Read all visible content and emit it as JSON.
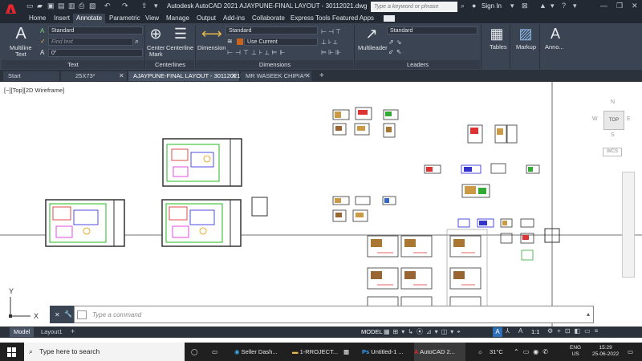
{
  "app": {
    "logo_letter": "A",
    "title": "Autodesk AutoCAD 2021    AJAYPUNE-FINAL LAYOUT - 30112021.dwg",
    "search_placeholder": "Type a keyword or phrase",
    "sign_in": "Sign In"
  },
  "ribbon_tabs": [
    "Home",
    "Insert",
    "Annotate",
    "Parametric",
    "View",
    "Manage",
    "Output",
    "Add-ins",
    "Collaborate",
    "Express Tools",
    "Featured Apps"
  ],
  "ribbon": {
    "text_panel": {
      "title": "Text",
      "multiline": "Multiline",
      "text": "Text",
      "style": "Standard",
      "find_placeholder": "Find text",
      "height": "0\""
    },
    "centerlines_panel": {
      "title": "Centerlines",
      "center_mark_1": "Center",
      "center_mark_2": "Mark",
      "centerline": "Centerline"
    },
    "dimensions_panel": {
      "title": "Dimensions",
      "dimension": "Dimension",
      "style": "Standard",
      "layer": "Use Current"
    },
    "leaders_panel": {
      "title": "Leaders",
      "multileader": "Multileader",
      "style": "Standard"
    },
    "tables": "Tables",
    "markup": "Markup",
    "anno": "Anno..."
  },
  "file_tabs": [
    {
      "label": "Start",
      "active": false
    },
    {
      "label": "25X73*",
      "active": false
    },
    {
      "label": "AJAYPUNE-FINAL LAYOUT - 30112021*",
      "active": true
    },
    {
      "label": "MR WASEEK CHIPIA*",
      "active": false
    }
  ],
  "viewport_label": "[−][Top][2D Wireframe]",
  "viewcube": {
    "top": "TOP",
    "n": "N",
    "s": "S",
    "e": "E",
    "w": "W",
    "wcs": "WCS"
  },
  "ucs": {
    "x": "X",
    "y": "Y"
  },
  "command": {
    "placeholder": "Type a command"
  },
  "layout_tabs": [
    {
      "label": "Model",
      "active": true
    },
    {
      "label": "Layout1",
      "active": false
    }
  ],
  "status": {
    "model": "MODEL",
    "scale": "1:1"
  },
  "taskbar": {
    "search_placeholder": "Type here to search",
    "apps": [
      "Seller Dash...",
      "1-RROJECT...",
      "Untitled-1 ...",
      "AutoCAD 2..."
    ],
    "temp": "31°C",
    "lang1": "ENG",
    "lang2": "US",
    "time": "15:29",
    "date": "25-06-2022"
  }
}
